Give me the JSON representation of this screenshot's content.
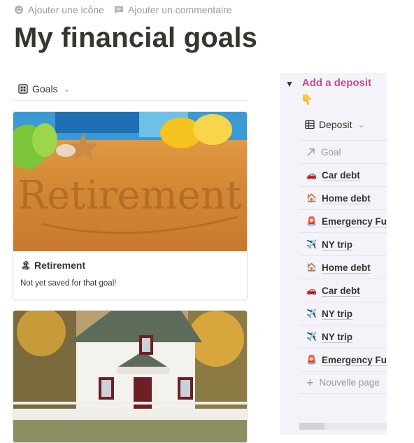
{
  "topbar": {
    "add_icon_label": "Ajouter une icône",
    "add_comment_label": "Ajouter un commentaire"
  },
  "page": {
    "title": "My financial goals"
  },
  "goals_view": {
    "label": "Goals"
  },
  "cards": [
    {
      "emoji": "🏝",
      "name": "Retirement",
      "description": "Not yet saved for that goal!",
      "cover_text": "Retirement"
    },
    {
      "emoji": "",
      "name": "",
      "description": ""
    }
  ],
  "sidebar": {
    "title": "Add a deposit",
    "emoji": "👇",
    "view_label": "Deposit",
    "column_header": "Goal",
    "rows": [
      {
        "emoji": "🚗",
        "label": "Car debt"
      },
      {
        "emoji": "🏠",
        "label": "Home debt"
      },
      {
        "emoji": "🚨",
        "label": "Emergency Fund"
      },
      {
        "emoji": "✈️",
        "label": "NY trip"
      },
      {
        "emoji": "🏠",
        "label": "Home debt"
      },
      {
        "emoji": "🚗",
        "label": "Car debt"
      },
      {
        "emoji": "✈️",
        "label": "NY trip"
      },
      {
        "emoji": "✈️",
        "label": "NY trip"
      },
      {
        "emoji": "🚨",
        "label": "Emergency Fund"
      }
    ],
    "new_page_label": "Nouvelle page"
  },
  "colors": {
    "accent": "#c44f97",
    "muted": "#9b9a97",
    "text": "#37352f"
  }
}
